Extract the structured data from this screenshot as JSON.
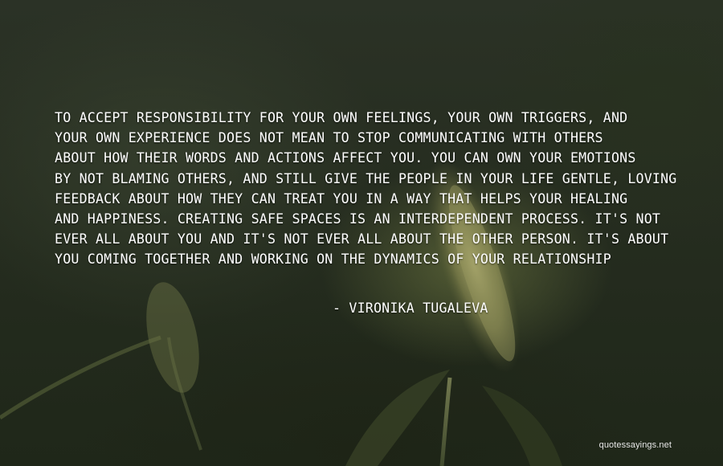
{
  "quote": {
    "lines": [
      "TO ACCEPT RESPONSIBILITY FOR YOUR OWN FEELINGS, YOUR OWN TRIGGERS, AND",
      "YOUR OWN EXPERIENCE DOES NOT MEAN TO STOP COMMUNICATING WITH OTHERS",
      "ABOUT HOW THEIR WORDS AND ACTIONS AFFECT YOU. YOU CAN OWN YOUR EMOTIONS",
      "BY NOT BLAMING OTHERS, AND STILL GIVE THE PEOPLE IN YOUR LIFE GENTLE, LOVING",
      "FEEDBACK ABOUT HOW THEY CAN TREAT YOU IN A WAY THAT HELPS YOUR HEALING",
      "AND HAPPINESS. CREATING SAFE SPACES IS AN INTERDEPENDENT PROCESS. IT'S NOT",
      "EVER ALL ABOUT YOU AND IT'S NOT EVER ALL ABOUT THE OTHER PERSON. IT'S ABOUT",
      "YOU COMING TOGETHER AND WORKING ON THE DYNAMICS OF YOUR RELATIONSHIP"
    ],
    "author": "- VIRONIKA TUGALEVA"
  },
  "watermark": "quotessayings.net"
}
